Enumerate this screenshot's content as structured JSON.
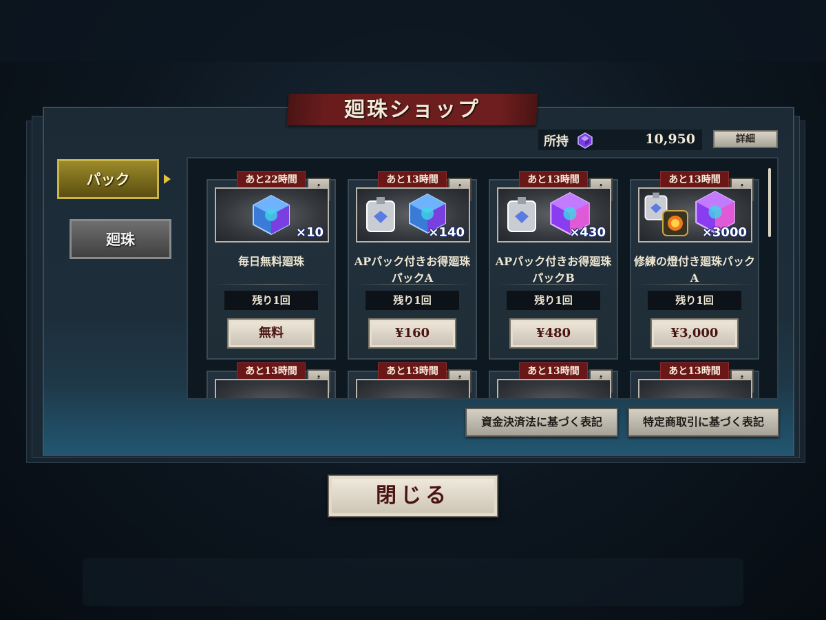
{
  "shop": {
    "title": "廻珠ショップ",
    "owned_label": "所持",
    "owned_value": "10,950",
    "owned_icon": "orb-gem-icon",
    "detail_label": "詳細"
  },
  "tabs": [
    {
      "label": "パック",
      "selected": true
    },
    {
      "label": "廻珠",
      "selected": false
    }
  ],
  "cards": [
    {
      "timer": "あと22時間",
      "info": "i",
      "qty": "×10",
      "name": "毎日無料廻珠",
      "remain": "残り1回",
      "price": "無料"
    },
    {
      "timer": "あと13時間",
      "info": "i",
      "qty": "×140",
      "name": "APパック付きお得廻珠パックA",
      "remain": "残り1回",
      "price": "¥160"
    },
    {
      "timer": "あと13時間",
      "info": "i",
      "qty": "×430",
      "name": "APパック付きお得廻珠パックB",
      "remain": "残り1回",
      "price": "¥480"
    },
    {
      "timer": "あと13時間",
      "info": "i",
      "qty": "×3000",
      "name": "修練の燈付き廻珠パックA",
      "remain": "残り1回",
      "price": "¥3,000"
    },
    {
      "timer": "あと13時間",
      "info": "i"
    },
    {
      "timer": "あと13時間",
      "info": "i"
    },
    {
      "timer": "あと13時間",
      "info": "i"
    },
    {
      "timer": "あと13時間",
      "info": "i"
    }
  ],
  "footer": {
    "payment_act": "資金決済法に基づく表記",
    "commerce_act": "特定商取引に基づく表記",
    "close": "閉じる"
  },
  "colors": {
    "accent_red": "#6a1717",
    "tab_gold": "#9b8a2a",
    "orb_purple": "#8a3cf0"
  }
}
